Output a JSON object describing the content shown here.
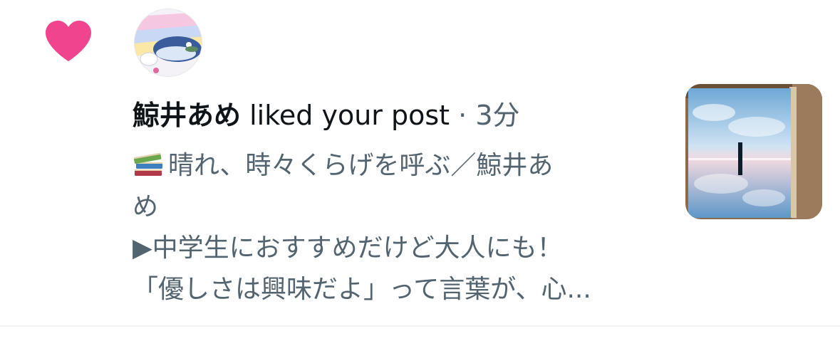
{
  "notification": {
    "icon": "heart-icon",
    "icon_color": "#f0448e",
    "username": "鯨井あめ",
    "action": "liked your post",
    "separator": "·",
    "time": "3分",
    "post_icon": "books-icon",
    "post_lines": [
      "晴れ、時々くらげを呼ぶ／鯨井あ",
      "め",
      "▶中学生におすすめだけど大人にも！",
      "「優しさは興味だよ」って言葉が、心..."
    ]
  },
  "colors": {
    "text_primary": "#0f1419",
    "text_secondary": "#536471",
    "divider": "#eff3f4"
  }
}
